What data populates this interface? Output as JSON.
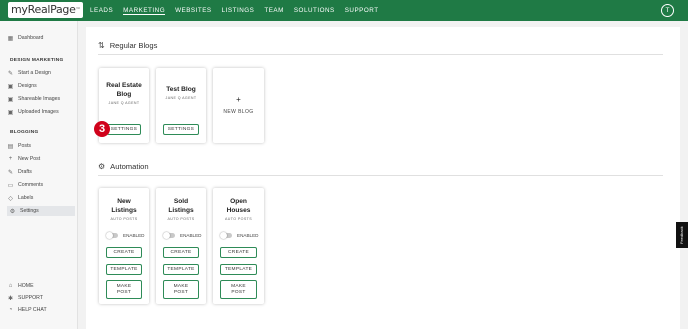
{
  "brand": {
    "logo_text": "myRealPage",
    "logo_tm": "™"
  },
  "nav": {
    "links": [
      "LEADS",
      "MARKETING",
      "WEBSITES",
      "LISTINGS",
      "TEAM",
      "SOLUTIONS",
      "SUPPORT"
    ],
    "active": "MARKETING",
    "avatar_initial": "T"
  },
  "sidebar": {
    "dashboard": "Dashboard",
    "design_heading": "DESIGN MARKETING",
    "design_items": [
      "Start a Design",
      "Designs",
      "Shareable Images",
      "Uploaded Images"
    ],
    "blogging_heading": "BLOGGING",
    "blogging_items": [
      "Posts",
      "New Post",
      "Drafts",
      "Comments",
      "Labels",
      "Settings"
    ],
    "selected": "Settings",
    "bottom_items": [
      "HOME",
      "SUPPORT",
      "HELP CHAT"
    ]
  },
  "regular_blogs": {
    "title": "Regular Blogs",
    "cards": [
      {
        "title": "Real Estate Blog",
        "title_line1": "Real Estate",
        "title_line2": "Blog",
        "author": "JANE Q AGENT",
        "button": "SETTINGS"
      },
      {
        "title": "Test Blog",
        "author": "JANE Q AGENT",
        "button": "SETTINGS"
      }
    ],
    "new_blog": {
      "plus": "+",
      "label": "NEW BLOG"
    }
  },
  "automation": {
    "title": "Automation",
    "cards": [
      {
        "title_line1": "New",
        "title_line2": "Listings",
        "subtitle": "AUTO POSTS",
        "toggle_label": "ENABLED",
        "enabled": false,
        "buttons": {
          "create": "CREATE",
          "template": "TEMPLATE",
          "make_post_line1": "MAKE",
          "make_post_line2": "POST"
        }
      },
      {
        "title_line1": "Sold",
        "title_line2": "Listings",
        "subtitle": "AUTO POSTS",
        "toggle_label": "ENABLED",
        "enabled": false,
        "buttons": {
          "create": "CREATE",
          "template": "TEMPLATE",
          "make_post_line1": "MAKE",
          "make_post_line2": "POST"
        }
      },
      {
        "title_line1": "Open",
        "title_line2": "Houses",
        "subtitle": "AUTO POSTS",
        "toggle_label": "ENABLED",
        "enabled": false,
        "buttons": {
          "create": "CREATE",
          "template": "TEMPLATE",
          "make_post_line1": "MAKE",
          "make_post_line2": "POST"
        }
      }
    ]
  },
  "step_badge": "3",
  "feedback_tab": "Feedback",
  "colors": {
    "nav_green": "#1f7a45",
    "button_border": "#2e8b57",
    "badge_red": "#d0021b"
  }
}
